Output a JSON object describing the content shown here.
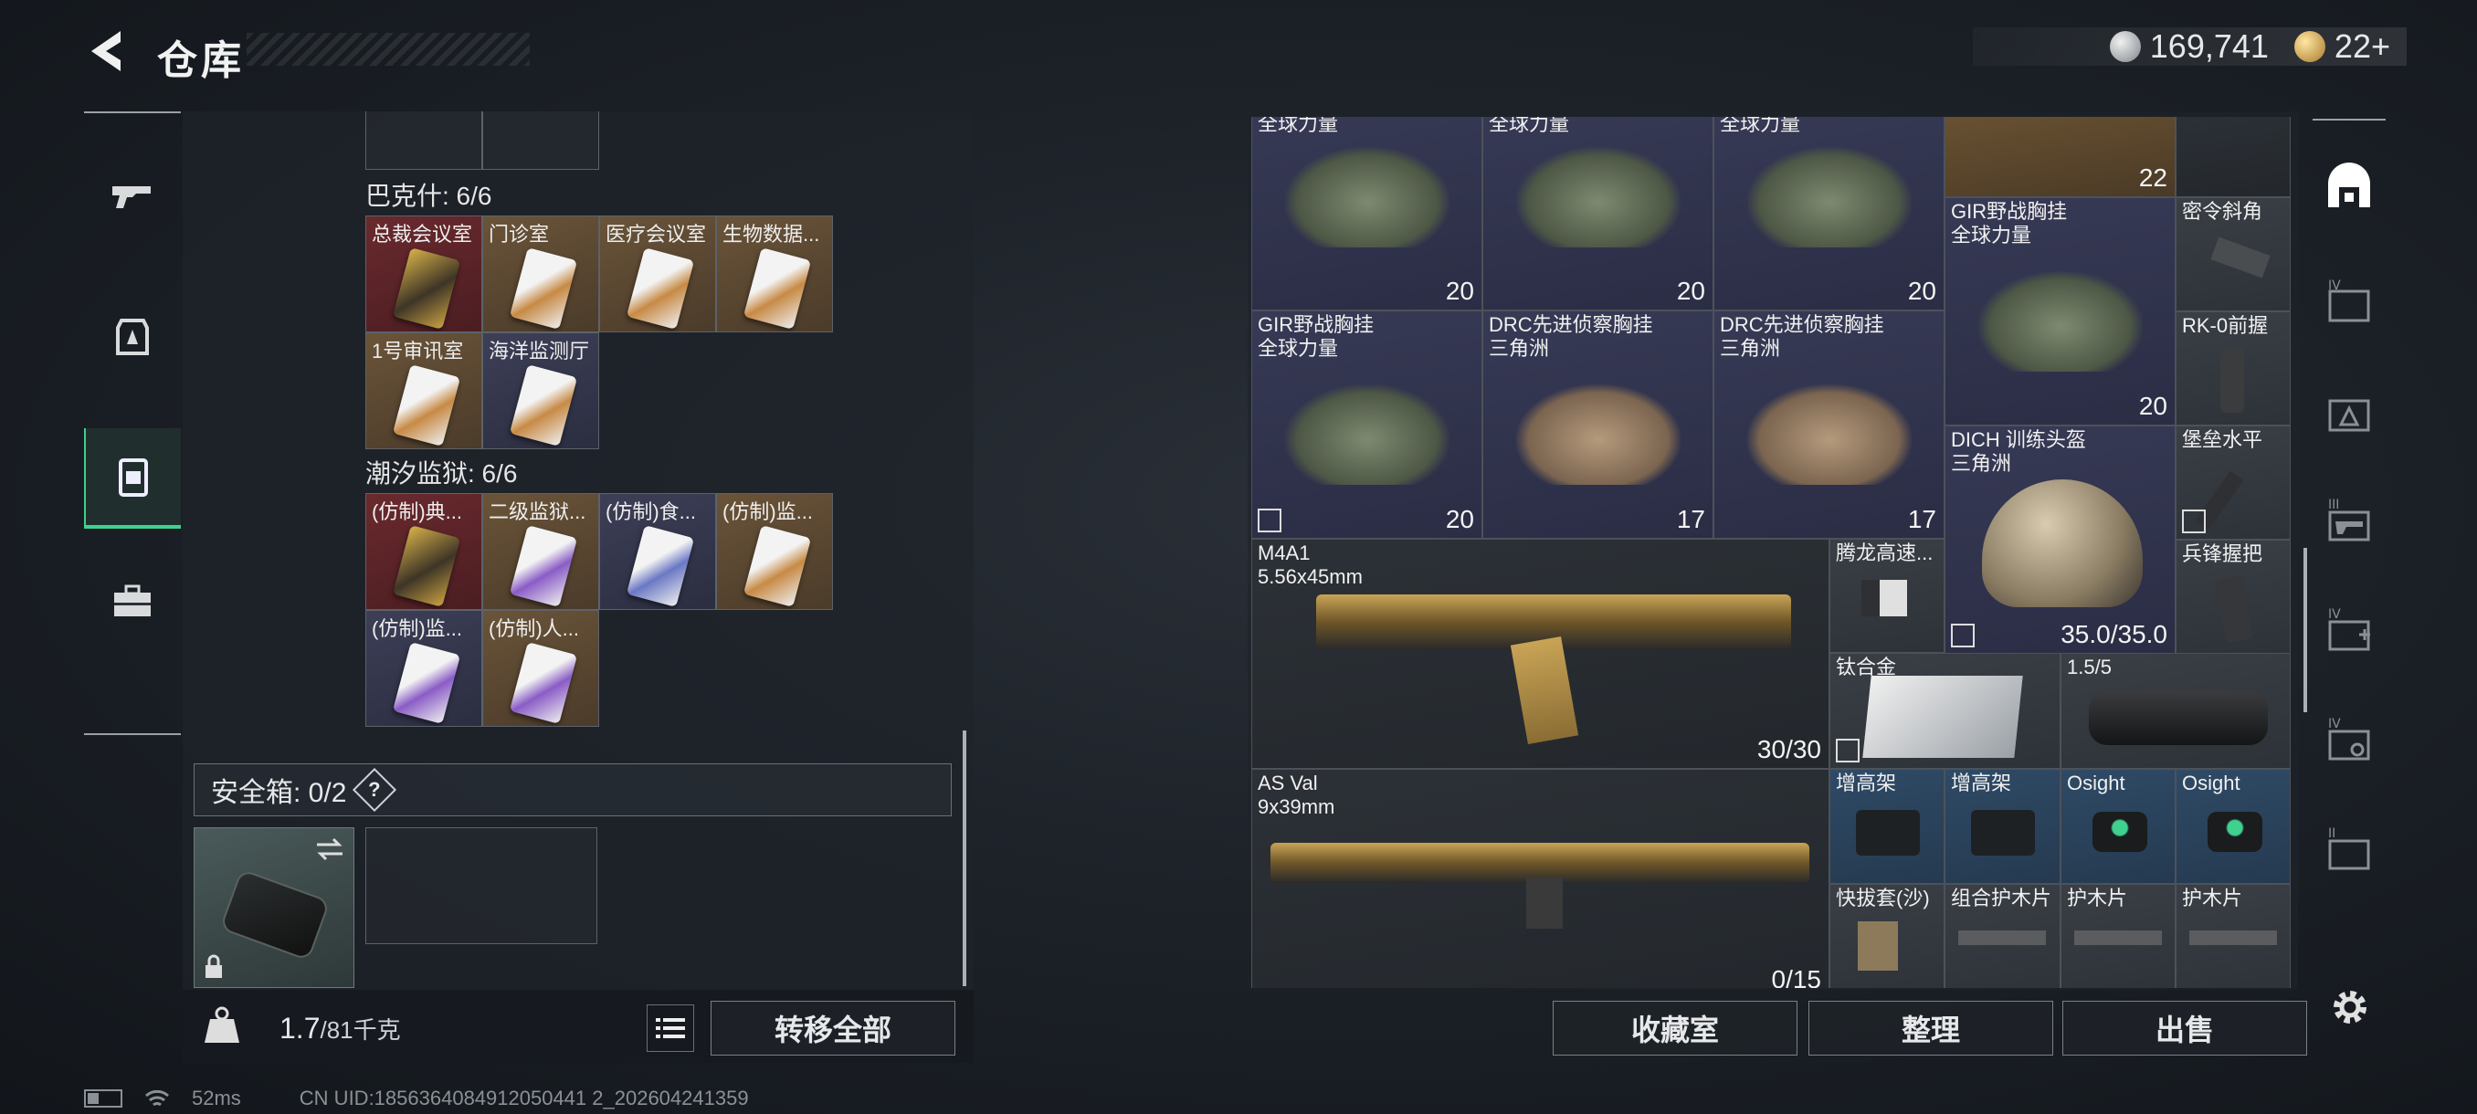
{
  "header": {
    "title": "仓库",
    "silver": "169,741",
    "gold": "22+"
  },
  "left_nav": [
    "gun-icon",
    "armor-icon",
    "storage-icon",
    "toolbox-icon"
  ],
  "sections": {
    "bakeshi": "巴克什: 6/6",
    "chaoxi": "潮汐监狱: 6/6"
  },
  "bakeshi_items": [
    "总裁会议室",
    "门诊室",
    "医疗会议室",
    "生物数据...",
    "1号审讯室",
    "海洋监测厅"
  ],
  "chaoxi_items": [
    "(仿制)典...",
    "二级监狱...",
    "(仿制)食...",
    "(仿制)监...",
    "(仿制)监...",
    "(仿制)人..."
  ],
  "safe": {
    "label": "安全箱: 0/2",
    "help": "?"
  },
  "weight": {
    "value": "1.7",
    "unit": "/81千克"
  },
  "buttons": {
    "transfer_all": "转移全部",
    "collection": "收藏室",
    "organize": "整理",
    "sell": "出售"
  },
  "grid": {
    "top_partial": [
      "全球力量",
      "全球力量",
      "全球力量"
    ],
    "r0_counts": [
      "20",
      "20",
      "20",
      "22"
    ],
    "vest1": "GIR野战胸挂\n全球力量",
    "grip1": "密令斜角",
    "vest2": "GIR野战胸挂\n全球力量",
    "vest3": "DRC先进侦察胸挂\n三角洲",
    "vest4": "DRC先进侦察胸挂\n三角洲",
    "grip2": "RK-0前握",
    "r1_count4": "20",
    "helmet": "DICH 训练头盔\n三角洲",
    "mount1": "堡垒水平",
    "r2_counts": [
      "20",
      "17",
      "17"
    ],
    "m4": "M4A1\n5.56x45mm",
    "m4_ammo": "30/30",
    "tenglong": "腾龙高速...",
    "helmet_dur": "35.0/35.0",
    "bingfeng": "兵锋握把",
    "titanium": "钛合金",
    "scope": "1.5/5",
    "asval": "AS Val\n9x39mm",
    "asval_ammo": "0/15",
    "riser1": "增高架",
    "riser2": "增高架",
    "osight1": "Osight",
    "osight2": "Osight",
    "holster": "快拔套(沙)",
    "handguard1": "组合护木片",
    "handguard2": "护木片",
    "handguard3": "护木片"
  },
  "status": {
    "ping": "52ms",
    "uid": "CN UID:1856364084912050441 2_202604241359"
  },
  "colors": {
    "accent": "#3fd18f",
    "purple_cell": "#373a55",
    "blue_cell": "#2f4a66",
    "gold_cell": "#6a5439",
    "red_cell": "#6a2a2e"
  }
}
